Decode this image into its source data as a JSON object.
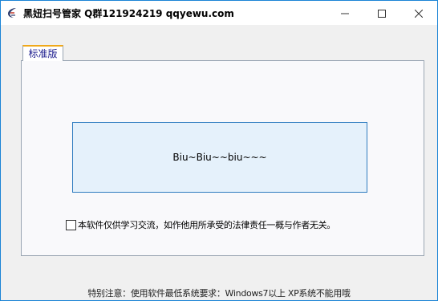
{
  "window": {
    "title": "黑妞扫号管家 Q群121924219 qqyewu.com",
    "icon": "app-logo-icon",
    "controls": {
      "minimize_icon": "minimize-icon",
      "maximize_icon": "maximize-icon",
      "close_icon": "close-icon"
    },
    "accent_color": "#1b84d6"
  },
  "tabs": [
    {
      "label": "标准版",
      "active": true
    }
  ],
  "main": {
    "status_text": "Biu~Biu~~biu~~~",
    "status_bg": "#e5f1fb",
    "status_border": "#2f7cc0",
    "disclaimer": {
      "checked": false,
      "label": "本软件仅供学习交流，如作他用所承受的法律责任一概与作者无关。"
    }
  },
  "footer": {
    "note": "特别注意：使用软件最低系统要求：Windows7以上 XP系统不能用哦"
  }
}
